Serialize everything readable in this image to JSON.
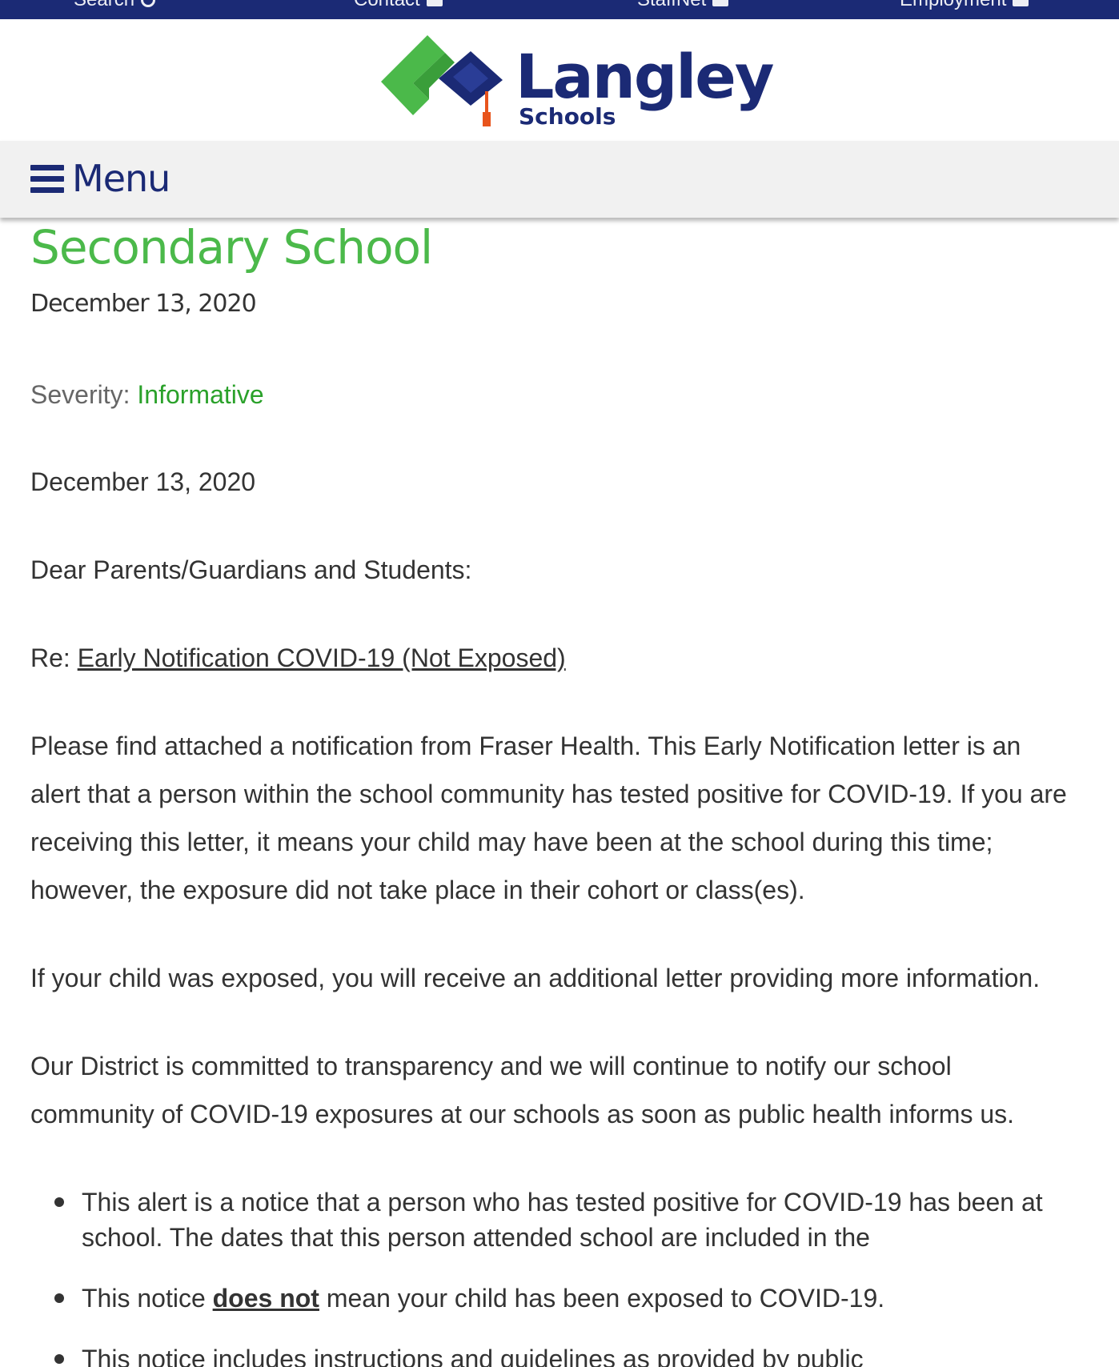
{
  "topbar": {
    "links": [
      {
        "label": "Search",
        "icon": "search-icon"
      },
      {
        "label": "Contact",
        "icon": "building-icon"
      },
      {
        "label": "StaffNet",
        "icon": "window-icon"
      },
      {
        "label": "Employment",
        "icon": "employment-icon"
      }
    ]
  },
  "brand": {
    "name": "Langley",
    "sub": "Schools",
    "colors": {
      "navy": "#1b2a75",
      "green": "#4bb94a",
      "orange": "#e8541c"
    }
  },
  "menu": {
    "label": "Menu",
    "icon": "hamburger-icon"
  },
  "article": {
    "title": "Secondary School",
    "posted_date": "December 13, 2020",
    "severity_label": "Severity:",
    "severity_value": "Informative",
    "letter_date": "December 13, 2020",
    "salutation": "Dear Parents/Guardians and Students:",
    "re_prefix": "Re:",
    "re_subject": "Early Notification COVID-19 (Not Exposed)",
    "paragraph1": [
      "Please find attached a notification from Fraser Health. This Early Notification letter is an",
      "alert that a person within the school community has tested positive for COVID-19. If you are",
      "receiving this letter, it means your child may have been at the school during this time;",
      "however, the exposure did not take place in their cohort or class(es)."
    ],
    "paragraph2": "If your child was exposed, you will receive an additional letter providing more information.",
    "paragraph3": [
      "Our District is committed to transparency and we will continue to notify our school",
      "community of COVID-19 exposures at our schools as soon as public health informs us."
    ],
    "bullets": [
      {
        "lines": [
          "This alert is a notice that a person who has tested positive for COVID-19 has been at",
          "school. The dates that this person attended school are included in the"
        ]
      },
      {
        "before": "This notice ",
        "emphasis": "does not",
        "after": " mean your child has been exposed to COVID-19."
      },
      {
        "lines": [
          "This notice includes instructions and guidelines as provided by public"
        ]
      }
    ]
  }
}
